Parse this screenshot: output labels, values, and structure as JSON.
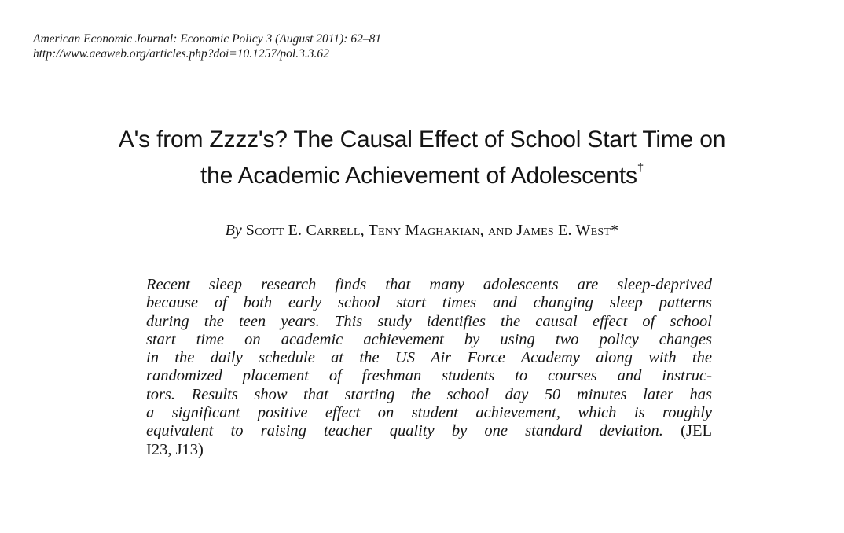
{
  "header": {
    "citation": "American Economic Journal: Economic Policy 3 (August 2011): 62–81",
    "url": "http://www.aeaweb.org/articles.php?doi=10.1257/pol.3.3.62"
  },
  "title": {
    "line1": "A's from Zzzz's? The Causal Effect of School Start Time on",
    "line2": "the Academic Achievement of Adolescents",
    "footnote_mark": "†"
  },
  "byline": {
    "by": "By",
    "authors": "Scott E. Carrell, Teny Maghakian, and James E. West*"
  },
  "abstract": {
    "lines": [
      "Recent sleep research finds that many adolescents are sleep-deprived",
      "because of both early school start times and changing sleep patterns",
      "during the teen years. This study identifies the causal effect of school",
      "start time on academic achievement by using two policy changes",
      "in the daily schedule at the US Air Force Academy along with the",
      "randomized placement of freshman students to courses and instruc-",
      "tors. Results show that starting the school day 50 minutes later has",
      "a significant positive effect on student achievement, which is roughly",
      "equivalent to raising teacher quality by one standard deviation."
    ],
    "jel_part1": "(JEL",
    "jel_part2": "I23, J13)"
  }
}
